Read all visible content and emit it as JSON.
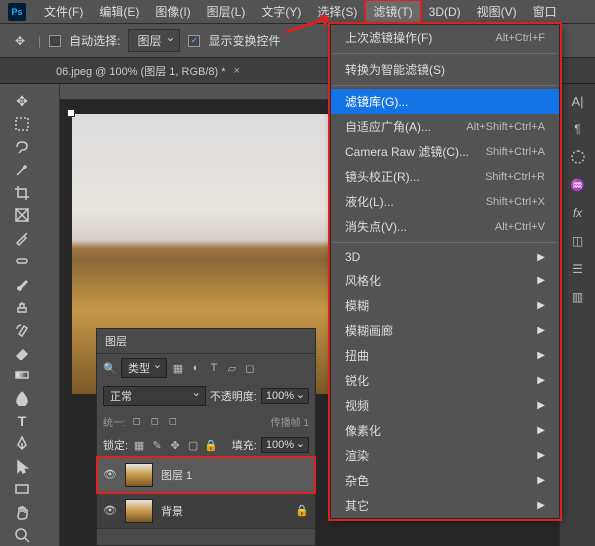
{
  "menubar": {
    "items": [
      "文件(F)",
      "编辑(E)",
      "图像(I)",
      "图层(L)",
      "文字(Y)",
      "选择(S)",
      "滤镜(T)",
      "3D(D)",
      "视图(V)",
      "窗口"
    ],
    "active_index": 6
  },
  "options_bar": {
    "auto_select": "自动选择:",
    "auto_select_target": "图层",
    "show_transform": "显示变换控件"
  },
  "document_tab": {
    "label": "06.jpeg @ 100% (图层 1, RGB/8) *"
  },
  "context_menu": {
    "groups": [
      [
        {
          "label": "上次滤镜操作(F)",
          "shortcut": "Alt+Ctrl+F"
        }
      ],
      [
        {
          "label": "转换为智能滤镜(S)",
          "shortcut": ""
        }
      ],
      [
        {
          "label": "滤镜库(G)...",
          "shortcut": "",
          "highlight": true
        },
        {
          "label": "自适应广角(A)...",
          "shortcut": "Alt+Shift+Ctrl+A"
        },
        {
          "label": "Camera Raw 滤镜(C)...",
          "shortcut": "Shift+Ctrl+A"
        },
        {
          "label": "镜头校正(R)...",
          "shortcut": "Shift+Ctrl+R"
        },
        {
          "label": "液化(L)...",
          "shortcut": "Shift+Ctrl+X"
        },
        {
          "label": "消失点(V)...",
          "shortcut": "Alt+Ctrl+V"
        }
      ],
      [
        {
          "label": "3D",
          "submenu": true
        },
        {
          "label": "风格化",
          "submenu": true
        },
        {
          "label": "模糊",
          "submenu": true
        },
        {
          "label": "模糊画廊",
          "submenu": true
        },
        {
          "label": "扭曲",
          "submenu": true
        },
        {
          "label": "锐化",
          "submenu": true
        },
        {
          "label": "视频",
          "submenu": true
        },
        {
          "label": "像素化",
          "submenu": true
        },
        {
          "label": "渲染",
          "submenu": true
        },
        {
          "label": "杂色",
          "submenu": true
        },
        {
          "label": "其它",
          "submenu": true
        }
      ]
    ]
  },
  "layers_panel": {
    "title": "图层",
    "kind": "类型",
    "blend": "正常",
    "opacity_label": "不透明度:",
    "opacity": "100%",
    "unify_label": "统一:",
    "propagate": "传播帧 1",
    "lock_label": "锁定:",
    "fill_label": "填充:",
    "fill": "100%",
    "layers": [
      {
        "name": "图层 1",
        "selected": true,
        "locked": false
      },
      {
        "name": "背景",
        "selected": false,
        "locked": true
      }
    ]
  }
}
